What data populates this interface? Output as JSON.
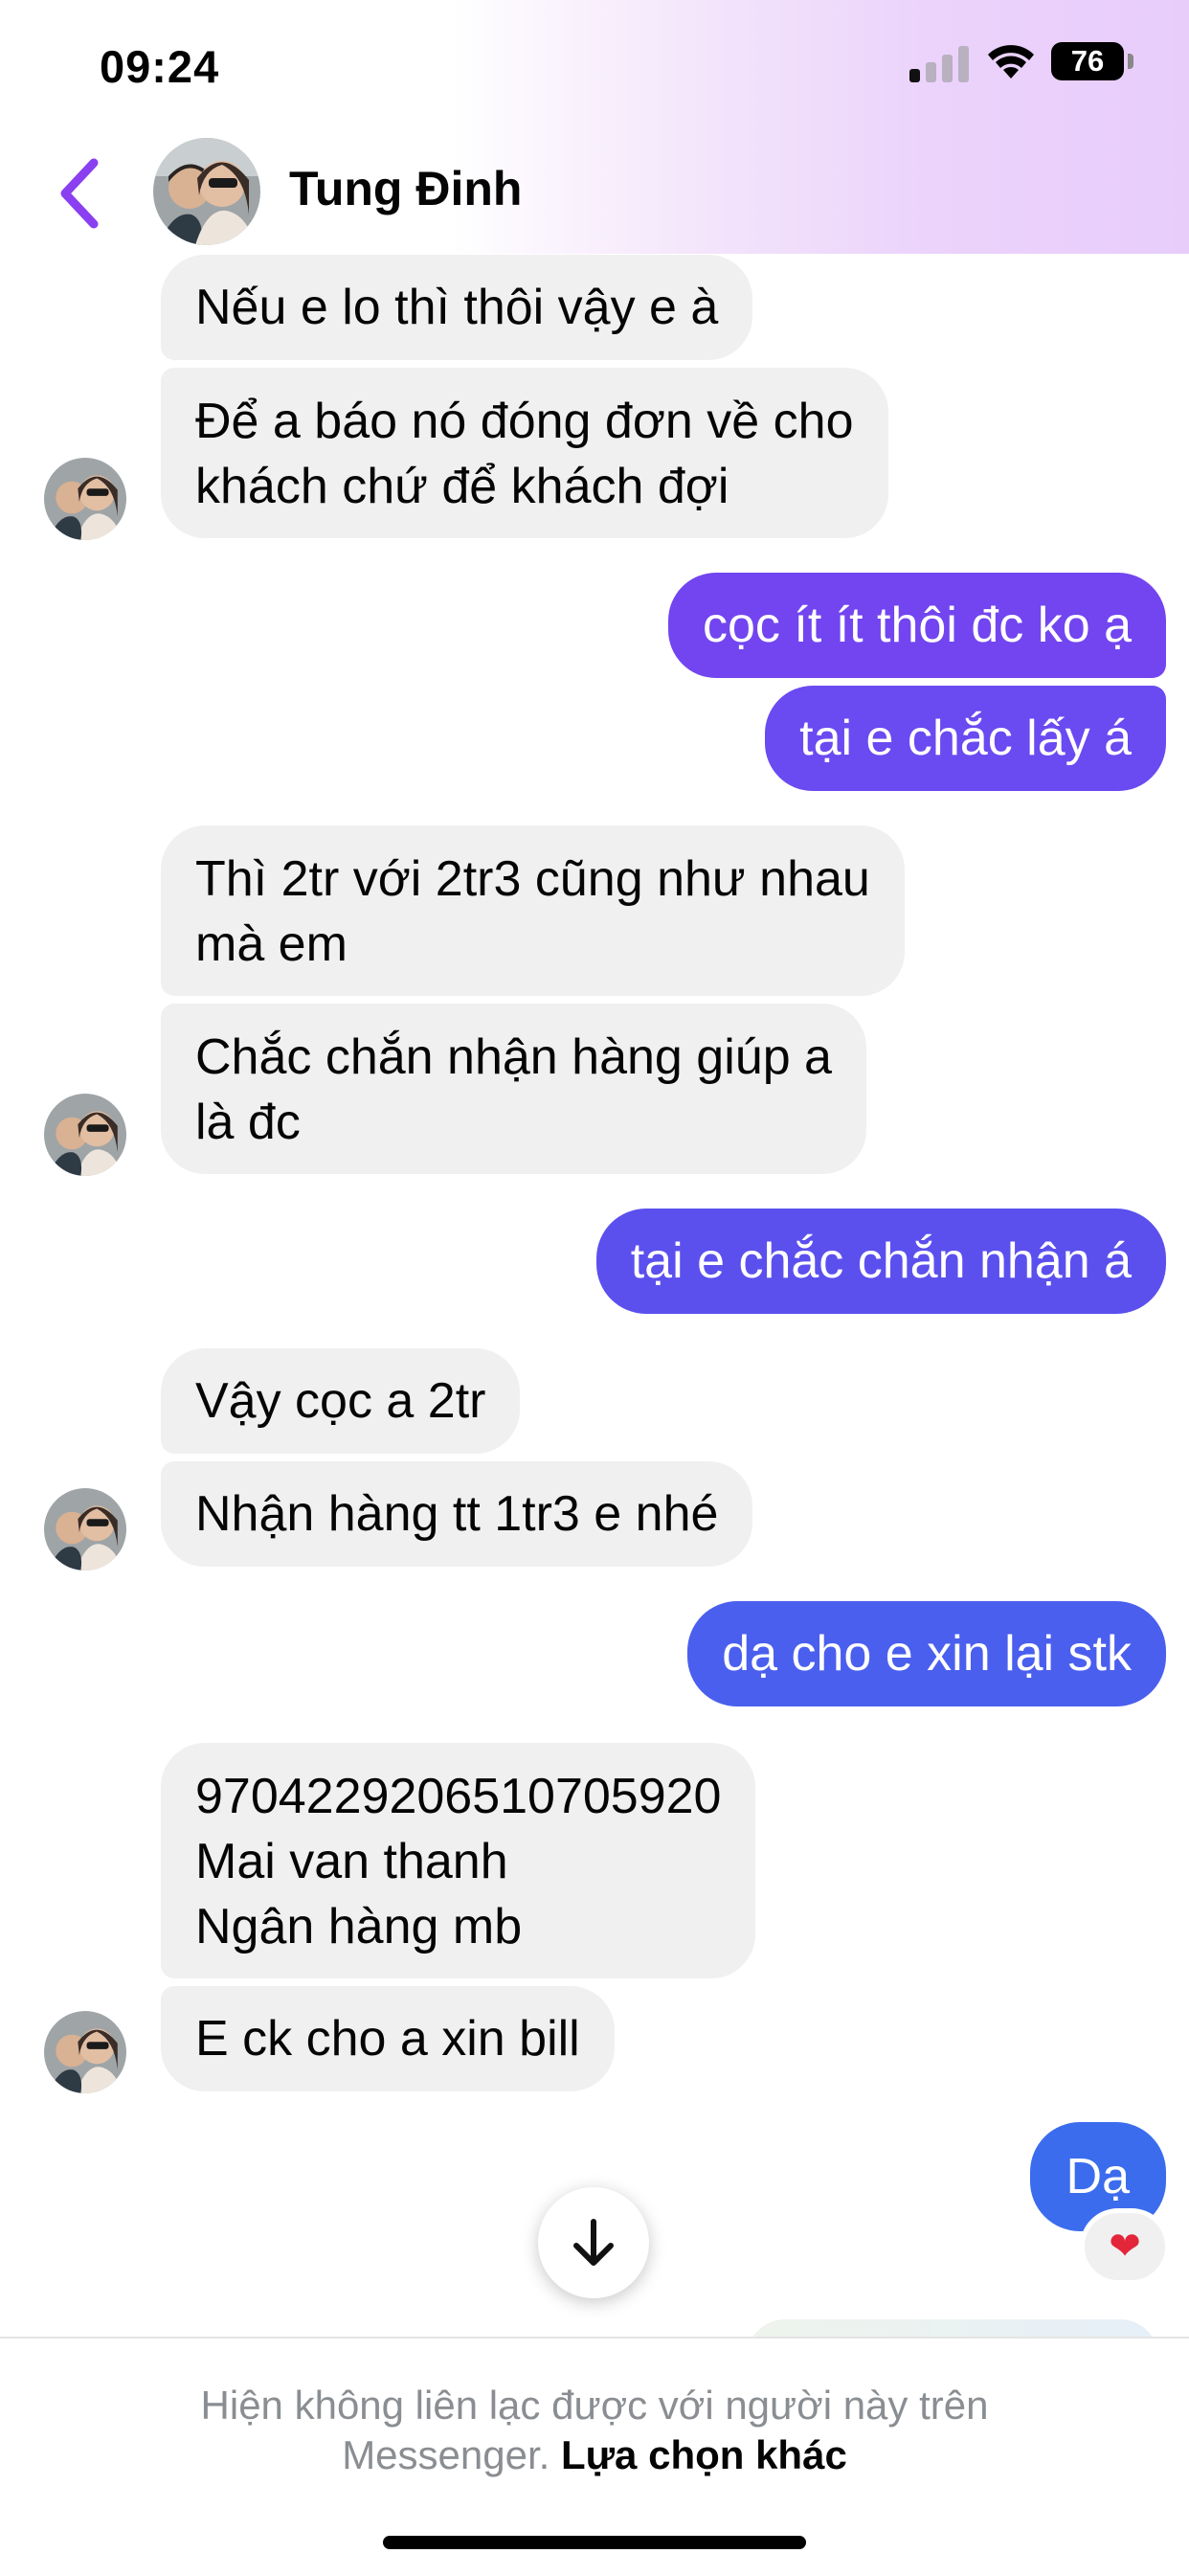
{
  "status_bar": {
    "time": "09:24",
    "battery": "76"
  },
  "header": {
    "contact_name": "Tung Đinh"
  },
  "messages": {
    "m1": "Nếu e lo thì thôi vậy e à",
    "m2_l1": "Để a báo nó đóng đơn về cho",
    "m2_l2": "khách chứ để khách đợi",
    "m3": "cọc ít ít thôi đc ko ạ",
    "m4": "tại e chắc lấy á",
    "m5_l1": "Thì 2tr với 2tr3 cũng như nhau",
    "m5_l2": "mà em",
    "m6_l1": "Chắc chắn nhận hàng giúp a",
    "m6_l2": "là đc",
    "m7": "tại e chắc chắn nhận á",
    "m8": "Vậy cọc a 2tr",
    "m9": "Nhận hàng tt 1tr3 e nhé",
    "m10": "dạ cho e xin lại stk",
    "m11_l1": "9704229206510705920",
    "m11_l2": "Mai van thanh",
    "m11_l3": "Ngân hàng mb",
    "m12": "E ck cho a xin bill",
    "m13": "Dạ"
  },
  "reaction": {
    "icon": "heart-icon"
  },
  "footer": {
    "notice_line1": "Hiện không liên lạc được với người này trên",
    "notice_line2": "Messenger.",
    "other_options": "Lựa chọn khác"
  },
  "colors": {
    "accent": "#7b3ff2",
    "incoming_bubble": "#f0f0f0"
  }
}
